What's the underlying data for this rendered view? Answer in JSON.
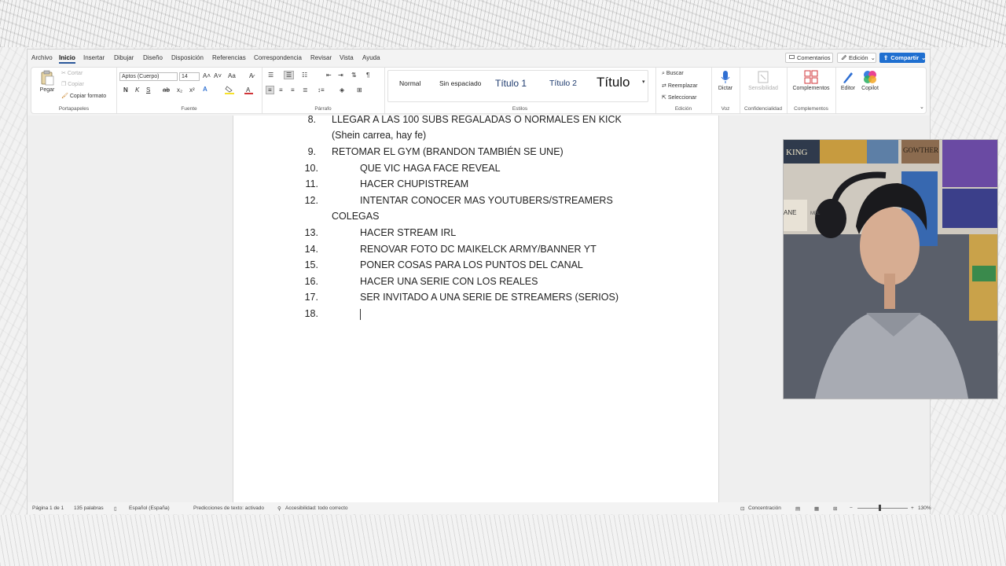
{
  "menu": {
    "tabs": [
      "Archivo",
      "Inicio",
      "Insertar",
      "Dibujar",
      "Diseño",
      "Disposición",
      "Referencias",
      "Correspondencia",
      "Revisar",
      "Vista",
      "Ayuda"
    ],
    "active_tab": "Inicio",
    "comments": "Comentarios",
    "editing": "Edición",
    "share": "Compartir"
  },
  "ribbon": {
    "clipboard": {
      "paste": "Pegar",
      "cut": "Cortar",
      "copy": "Copiar",
      "format_painter": "Copiar formato",
      "label": "Portapapeles"
    },
    "font": {
      "name": "Aptos (Cuerpo)",
      "size": "14",
      "label": "Fuente",
      "bold": "N",
      "italic": "K",
      "underline": "S",
      "strike": "ab",
      "subscript": "x₂",
      "superscript": "x²",
      "case": "Aa"
    },
    "paragraph": {
      "label": "Párrafo"
    },
    "styles": {
      "items": [
        "Normal",
        "Sin espaciado",
        "Título 1",
        "Título 2",
        "Título"
      ],
      "label": "Estilos"
    },
    "editing": {
      "search": "Buscar",
      "replace": "Reemplazar",
      "select": "Seleccionar",
      "label": "Edición"
    },
    "voice": {
      "dictate": "Dictar",
      "label": "Voz"
    },
    "sensitivity": {
      "button": "Sensibilidad",
      "label": "Confidencialidad"
    },
    "addins": {
      "button": "Complementos",
      "label": "Complementos"
    },
    "editor": "Editor",
    "copilot": "Copilot"
  },
  "document": {
    "lines": [
      {
        "num": "8.",
        "text": "LLEGAR A LAS 100 SUBS REGALADAS O NORMALES EN KICK"
      },
      {
        "num": "",
        "text": "(Shein carrea, hay fe)"
      },
      {
        "num": "9.",
        "text": "RETOMAR EL GYM (BRANDON TAMBIÉN SE UNE)"
      },
      {
        "num": "10.",
        "text": "QUE VIC HAGA FACE REVEAL"
      },
      {
        "num": "11.",
        "text": "HACER CHUPISTREAM"
      },
      {
        "num": "12.",
        "text": "INTENTAR CONOCER MAS YOUTUBERS/STREAMERS"
      },
      {
        "num": "",
        "text": "COLEGAS"
      },
      {
        "num": "13.",
        "text": "HACER STREAM IRL"
      },
      {
        "num": "14.",
        "text": "RENOVAR FOTO DC MAIKELCK ARMY/BANNER YT"
      },
      {
        "num": "15.",
        "text": "PONER COSAS PARA LOS PUNTOS DEL CANAL"
      },
      {
        "num": "16.",
        "text": "HACER UNA SERIE CON LOS REALES"
      },
      {
        "num": "17.",
        "text": "SER INVITADO A UNA SERIE DE STREAMERS (SERIOS)"
      },
      {
        "num": "18.",
        "text": ""
      }
    ]
  },
  "status": {
    "page": "Página 1 de 1",
    "words": "135 palabras",
    "language": "Español (España)",
    "predictions": "Predicciones de texto: activado",
    "accessibility": "Accesibilidad: todo correcto",
    "focus": "Concentración",
    "zoom": "130%"
  },
  "webcam": {
    "poster_text_1": "KING",
    "poster_text_2": "GOWTHER",
    "poster_text_3": "ANE",
    "poster_text_4": "MEL"
  }
}
